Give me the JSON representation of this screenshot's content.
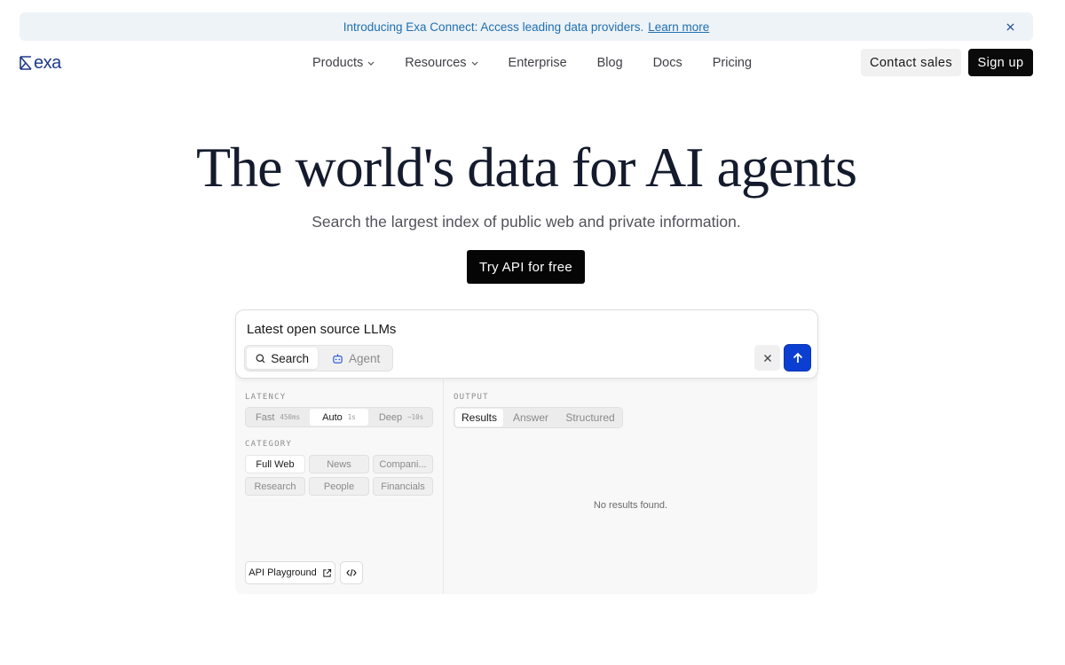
{
  "banner": {
    "text": "Introducing Exa Connect: Access leading data providers.",
    "link": "Learn more",
    "close_icon": "close-icon"
  },
  "header": {
    "logo_text": "exa",
    "nav": [
      {
        "label": "Products",
        "has_dropdown": true
      },
      {
        "label": "Resources",
        "has_dropdown": true
      },
      {
        "label": "Enterprise",
        "has_dropdown": false
      },
      {
        "label": "Blog",
        "has_dropdown": false
      },
      {
        "label": "Docs",
        "has_dropdown": false
      },
      {
        "label": "Pricing",
        "has_dropdown": false
      }
    ],
    "contact_label": "Contact sales",
    "signup_label": "Sign up"
  },
  "hero": {
    "title": "The world's data for AI agents",
    "subtitle": "Search the largest index of public web and private information.",
    "cta_label": "Try API for free"
  },
  "demo": {
    "query": "Latest open source LLMs",
    "modes": [
      {
        "label": "Search",
        "icon": "search-icon",
        "active": true
      },
      {
        "label": "Agent",
        "icon": "robot-icon",
        "active": false
      }
    ],
    "latency": {
      "label": "LATENCY",
      "options": [
        {
          "label": "Fast",
          "time": "450ms",
          "active": false
        },
        {
          "label": "Auto",
          "time": "1s",
          "active": true
        },
        {
          "label": "Deep",
          "time": "~10s",
          "active": false
        }
      ]
    },
    "category": {
      "label": "CATEGORY",
      "options": [
        {
          "label": "Full Web",
          "active": true
        },
        {
          "label": "News",
          "active": false
        },
        {
          "label": "Compani...",
          "active": false
        },
        {
          "label": "Research",
          "active": false
        },
        {
          "label": "People",
          "active": false
        },
        {
          "label": "Financials",
          "active": false
        }
      ]
    },
    "output": {
      "label": "OUTPUT",
      "tabs": [
        {
          "label": "Results",
          "active": true
        },
        {
          "label": "Answer",
          "active": false
        },
        {
          "label": "Structured",
          "active": false
        }
      ],
      "empty_text": "No results found."
    },
    "playground_label": "API Playground"
  },
  "colors": {
    "banner_bg": "#eef3f8",
    "banner_text": "#1f6fae",
    "submit_blue": "#0b3fd1",
    "logo_blue": "#1e3a8a"
  }
}
